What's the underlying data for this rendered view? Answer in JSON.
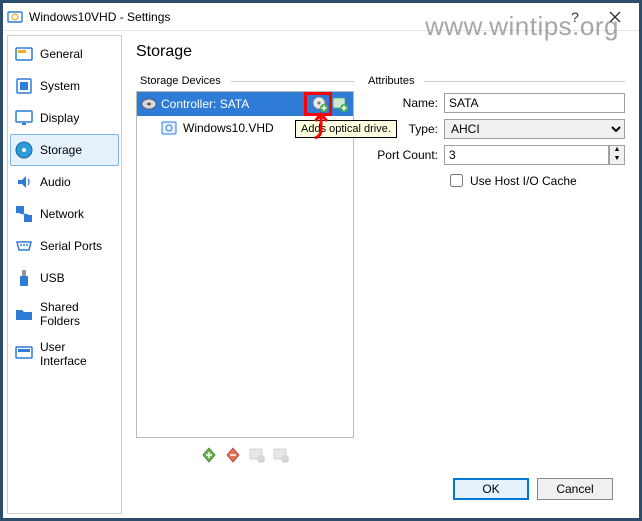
{
  "titlebar": {
    "title": "Windows10VHD - Settings"
  },
  "watermark": "www.wintips.org",
  "sidebar": {
    "items": [
      {
        "label": "General"
      },
      {
        "label": "System"
      },
      {
        "label": "Display"
      },
      {
        "label": "Storage"
      },
      {
        "label": "Audio"
      },
      {
        "label": "Network"
      },
      {
        "label": "Serial Ports"
      },
      {
        "label": "USB"
      },
      {
        "label": "Shared Folders"
      },
      {
        "label": "User Interface"
      }
    ],
    "active_index": 3
  },
  "page": {
    "title": "Storage"
  },
  "storage_devices": {
    "legend": "Storage Devices",
    "controller": {
      "label": "Controller: SATA"
    },
    "children": [
      {
        "label": "Windows10.VHD"
      }
    ],
    "tooltip": "Adds optical drive."
  },
  "attributes": {
    "legend": "Attributes",
    "name_label": "Name:",
    "name_value": "SATA",
    "type_label": "Type:",
    "type_value": "AHCI",
    "port_label": "Port Count:",
    "port_value": "3",
    "host_cache_label": "Use Host I/O Cache"
  },
  "footer": {
    "ok": "OK",
    "cancel": "Cancel"
  }
}
